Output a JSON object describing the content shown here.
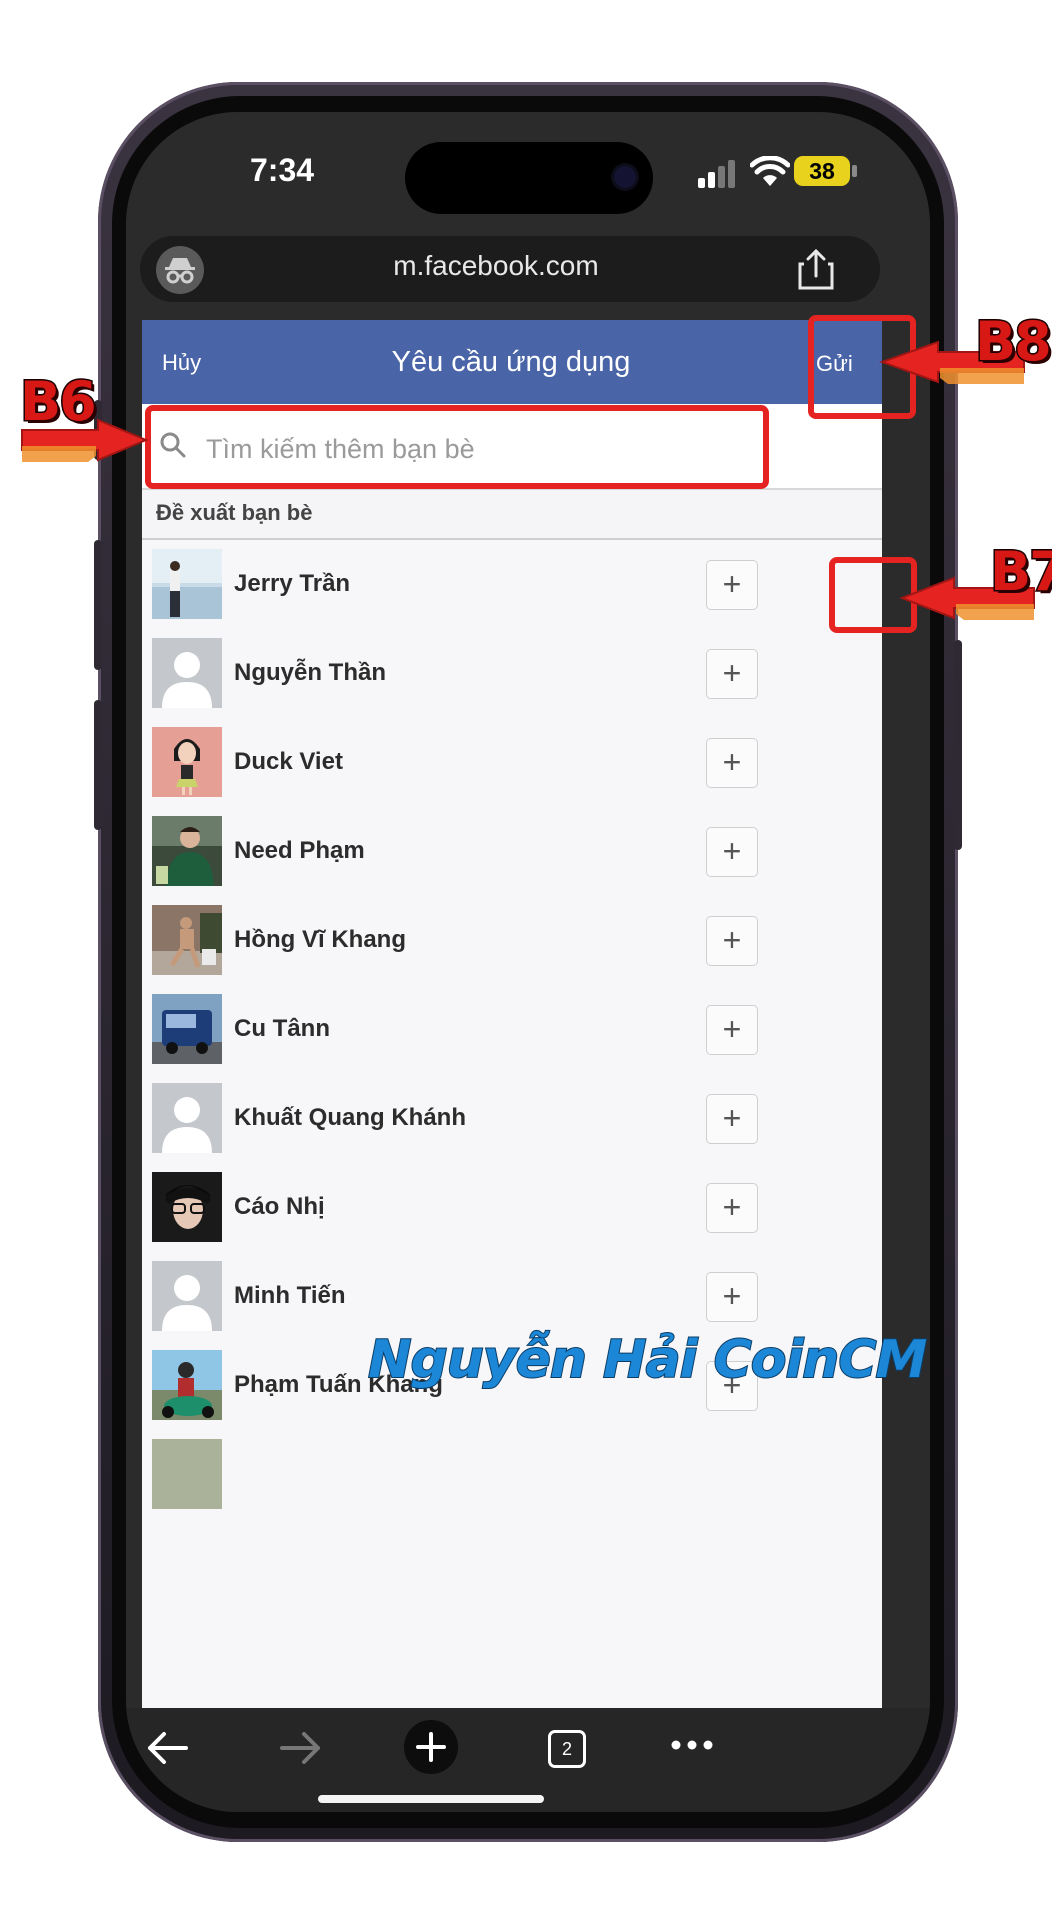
{
  "status_bar": {
    "time": "7:34",
    "battery": "38"
  },
  "browser": {
    "url": "m.facebook.com",
    "tab_count": "2"
  },
  "header": {
    "cancel": "Hủy",
    "title": "Yêu cầu ứng dụng",
    "send": "Gửi",
    "color": "#4a64a8"
  },
  "search": {
    "placeholder": "Tìm kiếm thêm bạn bè"
  },
  "section": {
    "label": "Đề xuất bạn bè"
  },
  "friends": [
    {
      "name": "Jerry Trần",
      "add_label": "+",
      "avatar": "photo-beach"
    },
    {
      "name": "Nguyễn Thần",
      "add_label": "+",
      "avatar": "default-avatar"
    },
    {
      "name": "Duck Viet",
      "add_label": "+",
      "avatar": "cartoon-avatar"
    },
    {
      "name": "Need Phạm",
      "add_label": "+",
      "avatar": "photo-person"
    },
    {
      "name": "Hồng Vĩ Khang",
      "add_label": "+",
      "avatar": "photo-person"
    },
    {
      "name": "Cu Tânn",
      "add_label": "+",
      "avatar": "photo-truck"
    },
    {
      "name": "Khuất Quang Khánh",
      "add_label": "+",
      "avatar": "default-avatar"
    },
    {
      "name": "Cáo Nhị",
      "add_label": "+",
      "avatar": "photo-person"
    },
    {
      "name": "Minh Tiến",
      "add_label": "+",
      "avatar": "default-avatar"
    },
    {
      "name": "Phạm Tuấn Khang",
      "add_label": "+",
      "avatar": "photo-motorbike"
    }
  ],
  "annotations": {
    "b6": "B6",
    "b7": "B7",
    "b8": "B8",
    "accent": "#e52320"
  },
  "watermark": "Nguyễn Hải CoinCM"
}
